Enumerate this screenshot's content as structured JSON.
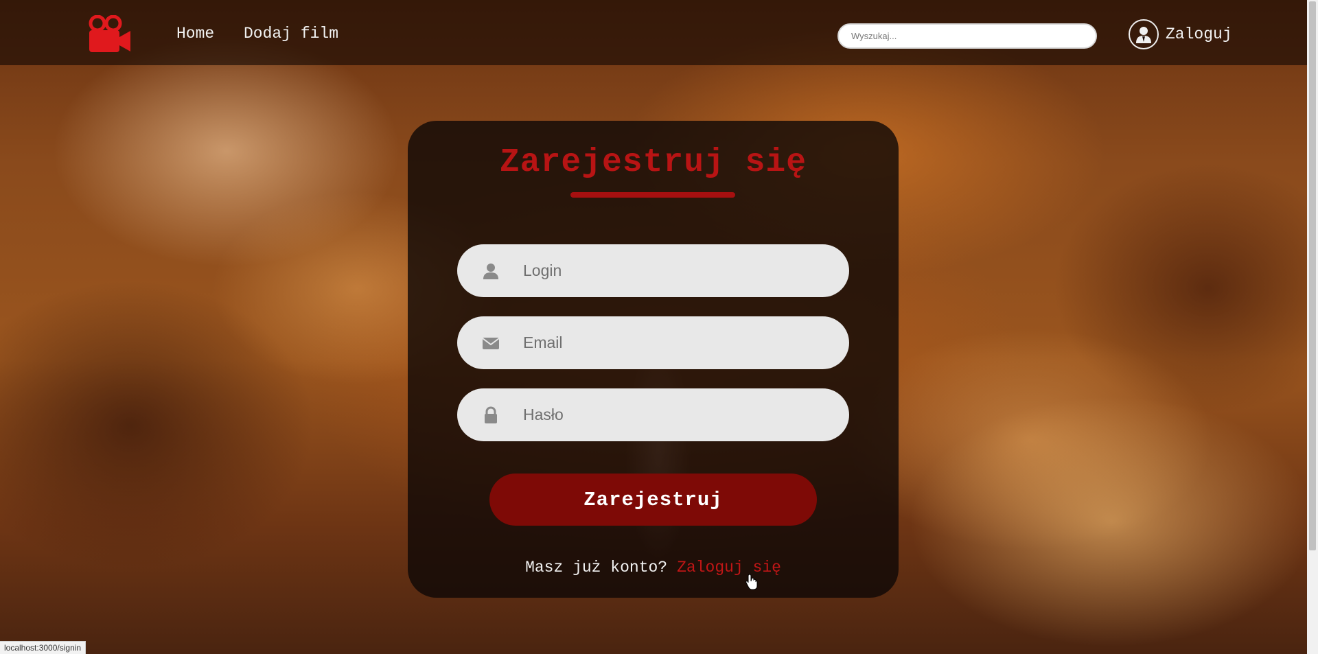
{
  "nav": {
    "logo_icon": "movie-camera-icon",
    "links": [
      "Home",
      "Dodaj film"
    ],
    "search_placeholder": "Wyszukaj...",
    "login_label": "Zaloguj",
    "avatar_icon": "user-icon"
  },
  "form": {
    "title": "Zarejestruj się",
    "fields": [
      {
        "placeholder": "Login",
        "icon": "user-icon"
      },
      {
        "placeholder": "Email",
        "icon": "envelope-icon"
      },
      {
        "placeholder": "Hasło",
        "icon": "lock-icon"
      }
    ],
    "submit_label": "Zarejestruj",
    "account_prompt": "Masz już konto?",
    "account_link": "Zaloguj się"
  },
  "status_bar": {
    "url": "localhost:3000/signin"
  },
  "colors": {
    "accent_red": "#b81414",
    "button_red": "#7e0a06",
    "field_bg": "#e8e8e8"
  }
}
